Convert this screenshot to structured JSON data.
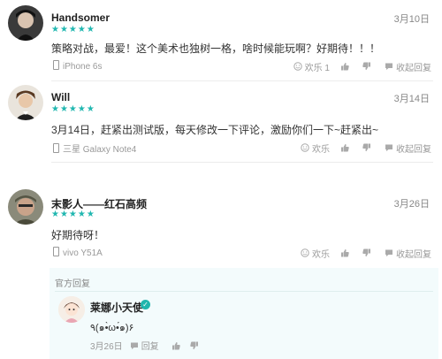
{
  "reviews": [
    {
      "name": "Handsomer",
      "stars": "★★★★★",
      "date": "3月10日",
      "text": "策略对战，最爱！这个美术也独树一格，啥时候能玩啊？好期待！！！",
      "device": "iPhone 6s",
      "likes_label": "欢乐 1",
      "collapse_label": "收起回复"
    },
    {
      "name": "Will",
      "stars": "★★★★★",
      "date": "3月14日",
      "text": "3月14日，赶紧出测试版，每天修改一下评论，激励你们一下~赶紧出~",
      "device": "三星 Galaxy Note4",
      "likes_label": "欢乐",
      "collapse_label": "收起回复"
    },
    {
      "name": "末影人——红石高频",
      "stars": "★★★★★",
      "date": "3月26日",
      "text": "好期待呀！",
      "device": "vivo Y51A",
      "likes_label": "欢乐",
      "collapse_label": "收起回复"
    }
  ],
  "official_reply": {
    "label": "官方回复",
    "name": "莱娜小天使",
    "text": "٩(๑•̀ω•́๑)۶",
    "date": "3月26日",
    "reply_label": "回复"
  },
  "colors": {
    "accent": "#21b7b0"
  }
}
